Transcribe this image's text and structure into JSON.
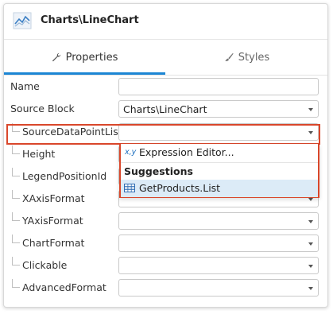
{
  "header": {
    "title": "Charts\\LineChart",
    "icon": "line-chart-icon"
  },
  "tabs": [
    {
      "label": "Properties",
      "icon": "wrench-icon",
      "active": true
    },
    {
      "label": "Styles",
      "icon": "brush-icon",
      "active": false
    }
  ],
  "properties": [
    {
      "label": "Name",
      "value": ""
    },
    {
      "label": "Source Block",
      "value": "Charts\\LineChart"
    },
    {
      "label": "SourceDataPointList",
      "value": ""
    },
    {
      "label": "Height",
      "value": ""
    },
    {
      "label": "LegendPositionId",
      "value": ""
    },
    {
      "label": "XAxisFormat",
      "value": ""
    },
    {
      "label": "YAxisFormat",
      "value": ""
    },
    {
      "label": "ChartFormat",
      "value": ""
    },
    {
      "label": "Clickable",
      "value": ""
    },
    {
      "label": "AdvancedFormat",
      "value": ""
    }
  ],
  "dropdown": {
    "expression_glyph": "x,y",
    "expression_label": "Expression Editor...",
    "suggestions_header": "Suggestions",
    "suggestion_item": "GetProducts.List"
  },
  "colors": {
    "accent": "#1c86d4",
    "highlight": "#d9472b",
    "selected": "#dcebf7"
  }
}
